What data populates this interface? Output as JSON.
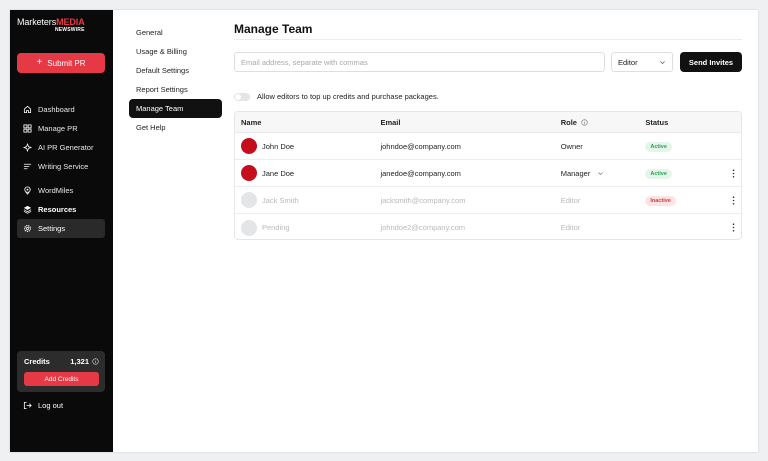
{
  "brand": {
    "name_part1": "Marketers",
    "name_part2": "MEDIA",
    "subtitle": "NEWSWIRE"
  },
  "sidebar": {
    "submit_label": "Submit PR",
    "items": [
      {
        "label": "Dashboard",
        "icon": "home-icon"
      },
      {
        "label": "Manage PR",
        "icon": "grid-icon"
      },
      {
        "label": "AI PR Generator",
        "icon": "sparkle-icon"
      },
      {
        "label": "Writing Service",
        "icon": "lines-icon"
      }
    ],
    "items2": [
      {
        "label": "WordMiles",
        "icon": "pin-icon"
      },
      {
        "label": "Resources",
        "icon": "layers-icon"
      },
      {
        "label": "Settings",
        "icon": "gear-icon"
      }
    ],
    "credits_label": "Credits",
    "credits_value": "1,321",
    "add_credits_label": "Add Credits",
    "logout_label": "Log out"
  },
  "submenu": {
    "items": [
      "General",
      "Usage & Billing",
      "Default Settings",
      "Report Settings",
      "Manage Team",
      "Get Help"
    ],
    "active": "Manage Team"
  },
  "main": {
    "title": "Manage Team",
    "email_placeholder": "Email address, separate with commas",
    "role_value": "Editor",
    "send_label": "Send Invites",
    "toggle_label": "Allow editors to top up credits and purchase packages.",
    "table": {
      "headers": {
        "name": "Name",
        "email": "Email",
        "role": "Role",
        "status": "Status"
      },
      "rows": [
        {
          "name": "John Doe",
          "email": "johndoe@company.com",
          "role": "Owner",
          "status": "Active"
        },
        {
          "name": "Jane Doe",
          "email": "janedoe@company.com",
          "role": "Manager",
          "status": "Active"
        },
        {
          "name": "Jack Smith",
          "email": "jacksmith@company.com",
          "role": "Editor",
          "status": "Inactive"
        },
        {
          "name": "Pending",
          "email": "johndoe2@company.com",
          "role": "Editor",
          "status": ""
        }
      ]
    }
  },
  "colors": {
    "accent": "#e63946",
    "sidebar_bg": "#0a0a0a",
    "active_green": "#2e9e50",
    "inactive_red": "#d33a3a"
  }
}
